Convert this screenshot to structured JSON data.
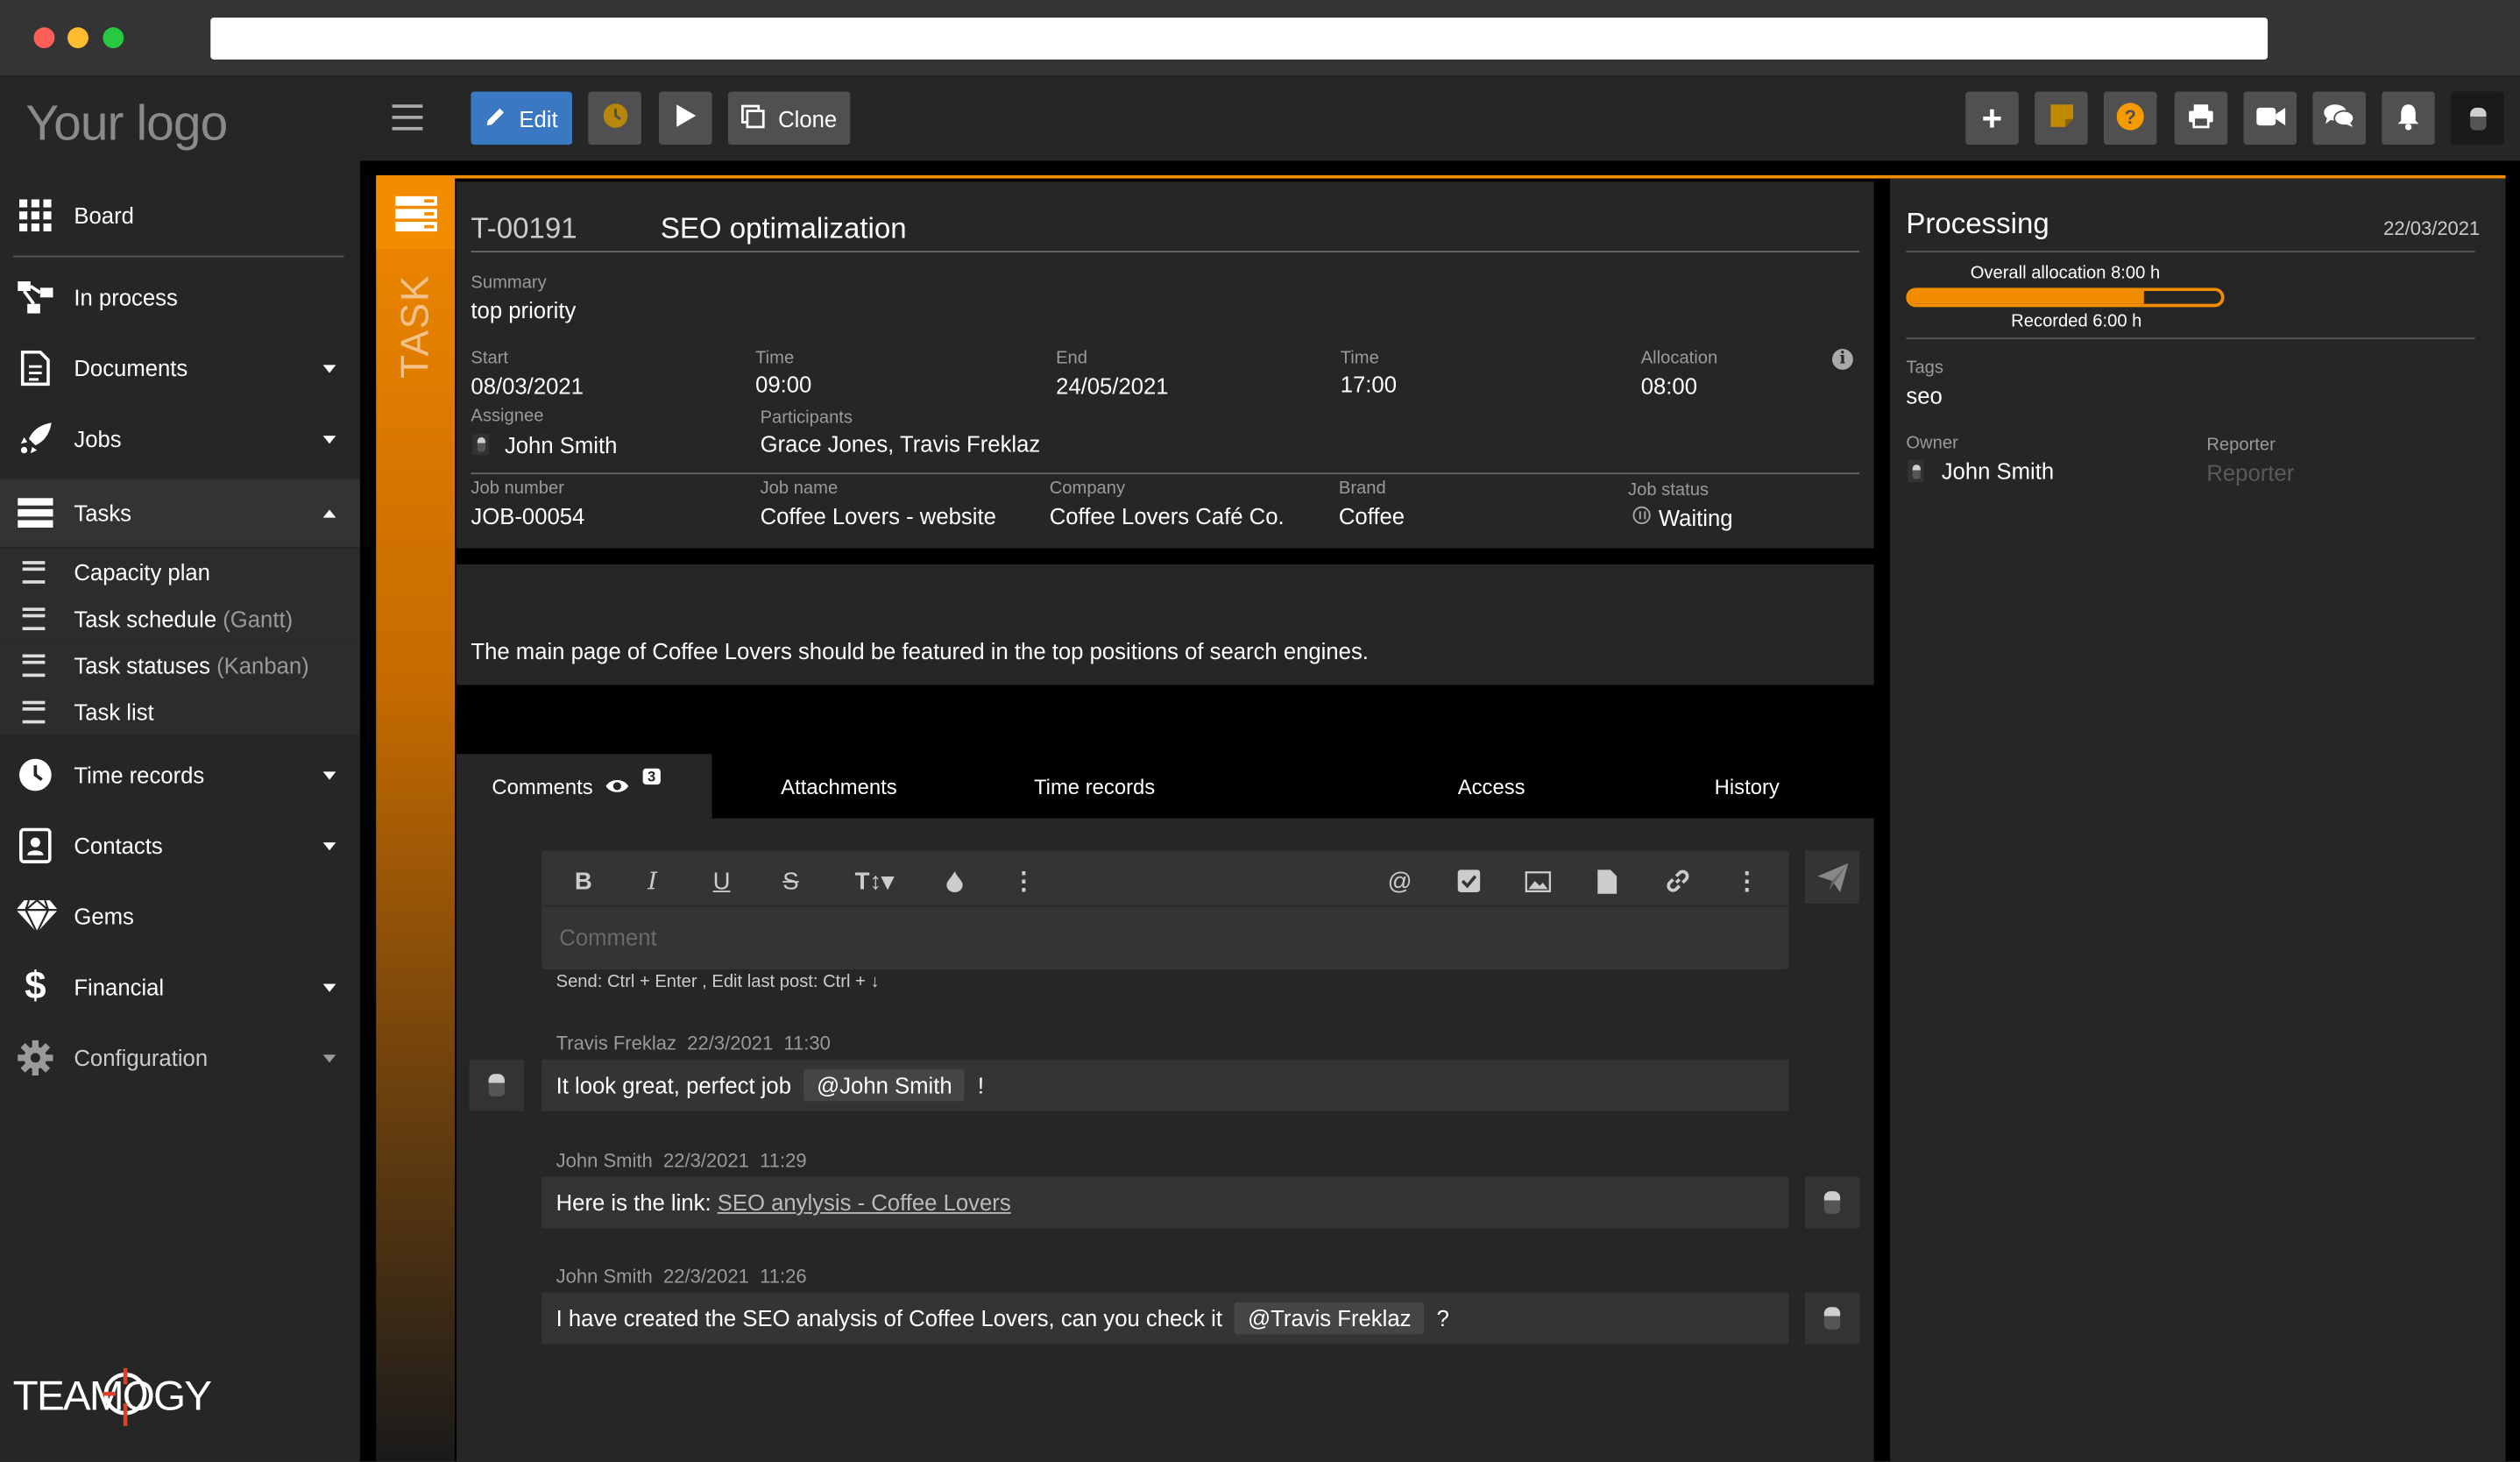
{
  "logo": "Your logo",
  "brand_logo": "TEAMOGY",
  "sidebar": {
    "items": [
      {
        "label": "Board"
      },
      {
        "label": "In process"
      },
      {
        "label": "Documents"
      },
      {
        "label": "Jobs"
      },
      {
        "label": "Tasks"
      },
      {
        "label": "Time records"
      },
      {
        "label": "Contacts"
      },
      {
        "label": "Gems"
      },
      {
        "label": "Financial"
      },
      {
        "label": "Configuration"
      }
    ],
    "sub_items": [
      {
        "label": "Capacity plan",
        "extra": ""
      },
      {
        "label": "Task schedule",
        "extra": "(Gantt)"
      },
      {
        "label": "Task statuses",
        "extra": "(Kanban)"
      },
      {
        "label": "Task list",
        "extra": ""
      }
    ]
  },
  "toolbar": {
    "edit_label": "Edit",
    "clone_label": "Clone"
  },
  "task": {
    "strip_label": "TASK",
    "id": "T-00191",
    "title": "SEO optimalization",
    "summary_label": "Summary",
    "summary": "top priority",
    "start_label": "Start",
    "start": "08/03/2021",
    "start_time_label": "Time",
    "start_time": "09:00",
    "end_label": "End",
    "end": "24/05/2021",
    "end_time_label": "Time",
    "end_time": "17:00",
    "allocation_label": "Allocation",
    "allocation": "08:00",
    "assignee_label": "Assignee",
    "assignee": "John Smith",
    "participants_label": "Participants",
    "participants": "Grace Jones, Travis Freklaz",
    "job_number_label": "Job number",
    "job_number": "JOB-00054",
    "job_name_label": "Job name",
    "job_name": "Coffee Lovers - website",
    "company_label": "Company",
    "company": "Coffee Lovers Café Co.",
    "brand_label": "Brand",
    "brand": "Coffee",
    "job_status_label": "Job status",
    "job_status": "Waiting",
    "description": "The main page of Coffee Lovers should be featured in the top positions of search engines."
  },
  "tabs": [
    {
      "label": "Comments",
      "badge": "3"
    },
    {
      "label": "Attachments"
    },
    {
      "label": "Time records"
    },
    {
      "label": "Access"
    },
    {
      "label": "History"
    }
  ],
  "editor": {
    "placeholder": "Comment",
    "hint": "Send: Ctrl + Enter , Edit last post: Ctrl + ↓"
  },
  "comments": [
    {
      "author": "Travis Freklaz",
      "date": "22/3/2021",
      "time": "11:30",
      "text_before": "It look great, perfect job",
      "mention": "@John Smith",
      "text_after": "!"
    },
    {
      "author": "John Smith",
      "date": "22/3/2021",
      "time": "11:29",
      "text_before": "Here is the link:",
      "link": "SEO anylysis - Coffee Lovers"
    },
    {
      "author": "John Smith",
      "date": "22/3/2021",
      "time": "11:26",
      "text_before": "I have created the SEO analysis of Coffee Lovers, can you check it",
      "mention": "@Travis Freklaz",
      "text_after": "?"
    }
  ],
  "status_panel": {
    "status": "Processing",
    "date": "22/03/2021",
    "overall_allocation": "Overall allocation 8:00 h",
    "recorded": "Recorded 6:00 h",
    "recorded_fraction": 0.75,
    "tags_label": "Tags",
    "tags": "seo",
    "owner_label": "Owner",
    "owner": "John Smith",
    "reporter_label": "Reporter",
    "reporter_placeholder": "Reporter"
  },
  "colors": {
    "accent_orange": "#f28c00",
    "edit_blue": "#3a78c2",
    "help_orange": "#f59b00",
    "mac_red": "#fe5f57",
    "mac_yellow": "#febc2e",
    "mac_green": "#28c840"
  }
}
